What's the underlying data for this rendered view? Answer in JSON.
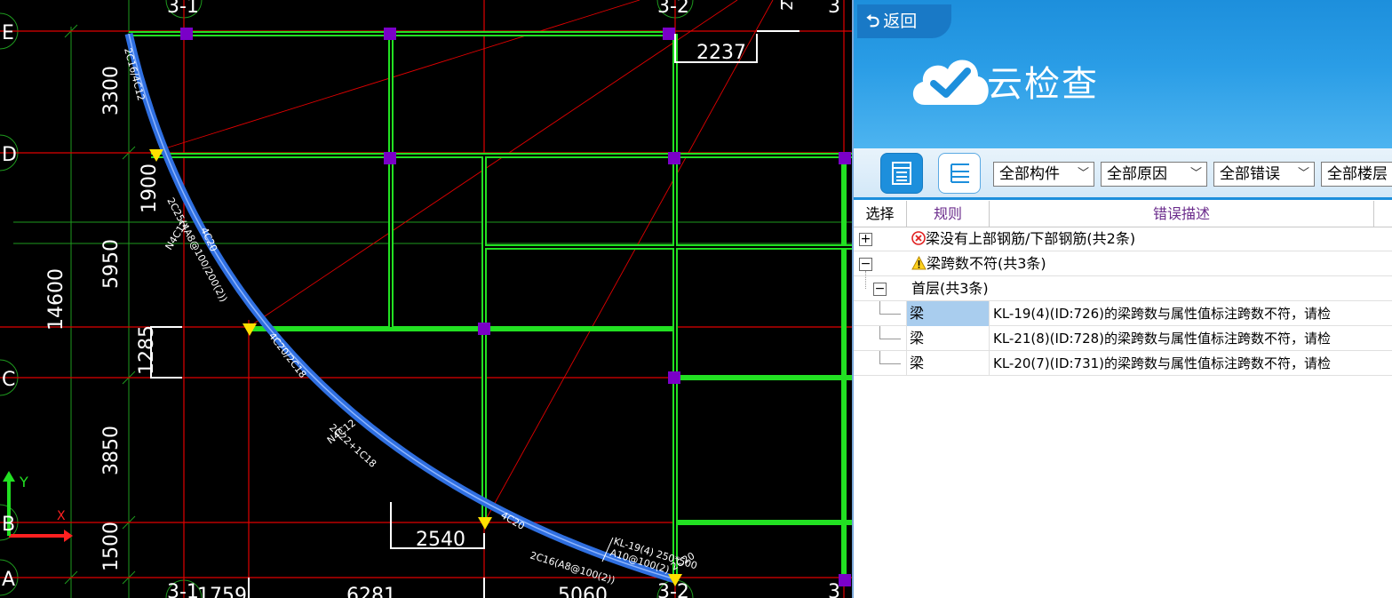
{
  "cad": {
    "axis_labels": {
      "E": "E",
      "D": "D",
      "C": "C",
      "B": "B",
      "A": "A",
      "top_1": "3-1",
      "top_2": "3-2",
      "top_3": "3",
      "bottom_1": "3-1",
      "bottom_2": "3-2",
      "bottom_3": "3",
      "top_partial": "2"
    },
    "dimensions": {
      "d3300": "3300",
      "d1900": "1900",
      "d5950": "5950",
      "d14600": "14600",
      "d1285": "1285",
      "d3850": "3850",
      "d1500": "1500",
      "d2237": "2237",
      "d2540": "2540",
      "b1759": "1759",
      "b6281": "6281",
      "b5060": "5060"
    },
    "beam_annotations": {
      "a1": "2C16/4C12",
      "a2": "4C20",
      "a3": "2C25(4A8@100/200(2))",
      "a4": "N4C12",
      "a5": "4C20/2C18",
      "a6": "2C22+1C18",
      "a7": "N4C12",
      "a8": "4C20",
      "a9": "KL-19(4) 250*500",
      "a10": "A10@100(2)",
      "a11": "2C20",
      "a12": "2C16(A8@100(2))"
    },
    "ucs": {
      "x": "X",
      "y": "Y"
    },
    "colors": {
      "axis": "#e00000",
      "beam": "#22e022",
      "arc": "#2f6fe0",
      "column": "#7a00c8",
      "dim": "#ffffff",
      "grid_dim": "#1e9a1e"
    }
  },
  "panel": {
    "back_label": "返回",
    "title": "云检查",
    "toolbar": {
      "list_icon": "list-view-icon",
      "tree_icon": "tree-view-icon",
      "filters": [
        {
          "value": "全部构件"
        },
        {
          "value": "全部原因"
        },
        {
          "value": "全部错误"
        },
        {
          "value": "全部楼层"
        }
      ]
    },
    "grid": {
      "headers": {
        "select": "选择",
        "rule": "规则",
        "desc": "错误描述"
      },
      "groups": [
        {
          "expander": "+",
          "icon": "error-icon",
          "text": "梁没有上部钢筋/下部钢筋(共2条)"
        },
        {
          "expander": "−",
          "icon": "warning-icon",
          "text": "梁跨数不符(共3条)"
        }
      ],
      "subgroup": {
        "expander": "−",
        "text": "首层(共3条)"
      },
      "rows": [
        {
          "rule": "梁",
          "desc": "KL-19(4)(ID:726)的梁跨数与属性值标注跨数不符，请检",
          "selected": true
        },
        {
          "rule": "梁",
          "desc": "KL-21(8)(ID:728)的梁跨数与属性值标注跨数不符，请检",
          "selected": false
        },
        {
          "rule": "梁",
          "desc": "KL-20(7)(ID:731)的梁跨数与属性值标注跨数不符，请检",
          "selected": false
        }
      ],
      "header_color": "#6b2c8c",
      "selected_color": "#a9cdee"
    }
  }
}
